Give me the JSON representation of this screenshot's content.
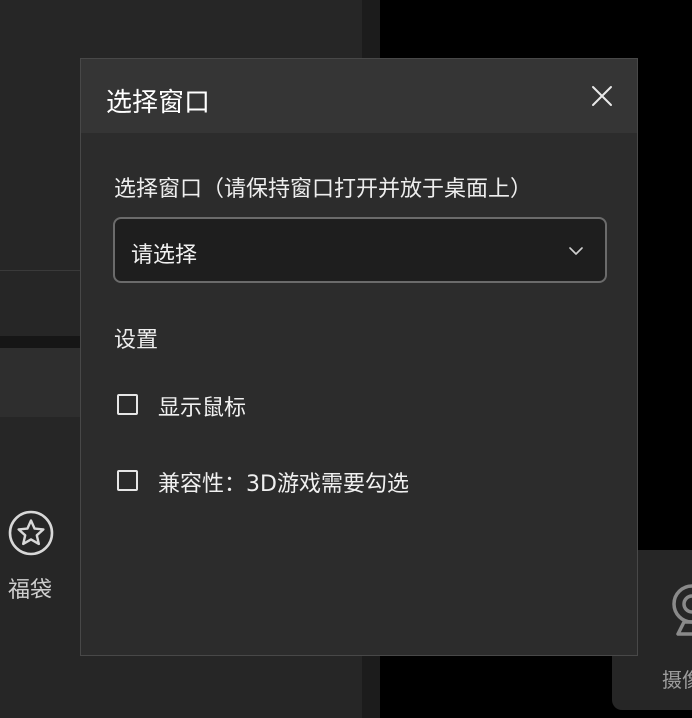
{
  "dialog": {
    "title": "选择窗口",
    "close_icon": "close-icon",
    "window_select": {
      "label": "选择窗口（请保持窗口打开并放于桌面上）",
      "value": "请选择",
      "icon": "chevron-down-icon"
    },
    "settings": {
      "label": "设置",
      "options": [
        {
          "label": "显示鼠标",
          "checked": false
        },
        {
          "label": "兼容性：3D游戏需要勾选",
          "checked": false
        }
      ]
    }
  },
  "background": {
    "gift_label": "福袋",
    "gift_icon": "star-circle-icon",
    "camera_label": "摄像",
    "camera_icon": "webcam-icon"
  }
}
